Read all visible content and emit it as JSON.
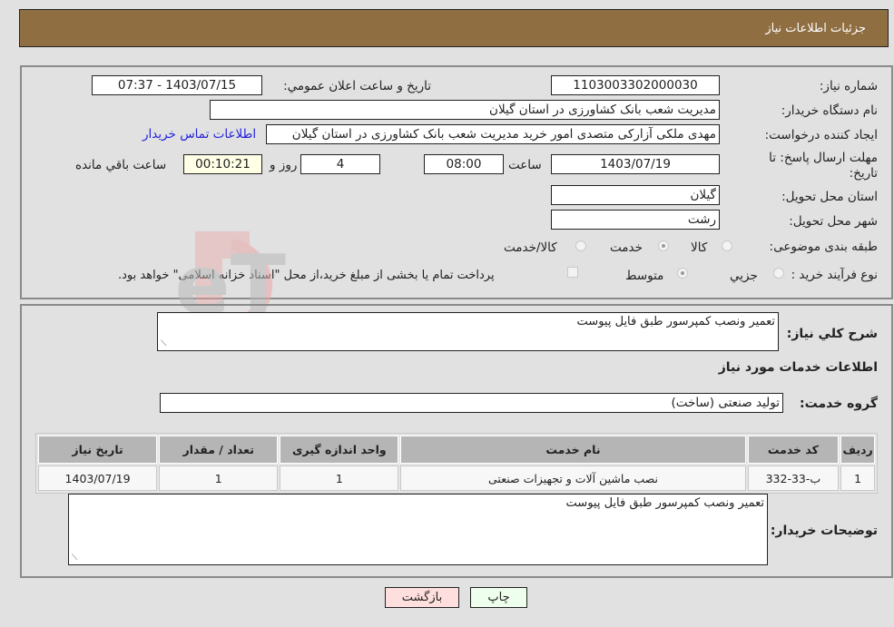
{
  "header": {
    "title": "جزئیات اطلاعات نیاز"
  },
  "form": {
    "need_number": {
      "label": "شماره نیاز:",
      "value": "1103003302000030"
    },
    "announce_datetime": {
      "label": "تاریخ و ساعت اعلان عمومي:",
      "value": "1403/07/15 - 07:37"
    },
    "buyer_org": {
      "label": "نام دستگاه خریدار:",
      "value": "مدیریت شعب بانک کشاورزی در استان گیلان"
    },
    "requester": {
      "label": "ایجاد کننده درخواست:",
      "value": "مهدی ملکی آزارکی متصدی امور خرید مدیریت شعب بانک کشاورزی در استان گیلان"
    },
    "buyer_contact_link": "اطلاعات تماس خریدار",
    "deadline": {
      "label": "مهلت ارسال پاسخ: تا تاریخ:",
      "date": "1403/07/19",
      "time_label": "ساعت",
      "time": "08:00",
      "days": "4",
      "days_label": "روز و",
      "remaining": "00:10:21",
      "remaining_label": "ساعت باقي مانده"
    },
    "delivery_province": {
      "label": "استان محل تحویل:",
      "value": "گیلان"
    },
    "delivery_city": {
      "label": "شهر محل تحویل:",
      "value": "رشت"
    },
    "category": {
      "label": "طبقه بندی موضوعی:",
      "options": [
        "کالا",
        "خدمت",
        "کالا/خدمت"
      ],
      "selected": "خدمت"
    },
    "purchase_type": {
      "label": "نوع فرآیند خرید :",
      "options": [
        "جزيي",
        "متوسط"
      ],
      "selected": "متوسط",
      "treasury_note": "پرداخت تمام یا بخشی از مبلغ خرید،از محل \"اسناد خزانه اسلامی\" خواهد بود."
    }
  },
  "details": {
    "general_desc_label": "شرح کلي نياز:",
    "general_desc": "تعمیر ونصب کمپرسور طبق فایل پیوست",
    "services_heading": "اطلاعات خدمات مورد نیاز",
    "service_group_label": "گروه خدمت:",
    "service_group": "تولید صنعتی (ساخت)",
    "table": {
      "headers": [
        "ردیف",
        "کد خدمت",
        "نام خدمت",
        "واحد اندازه گیری",
        "تعداد / مقدار",
        "تاریخ نیاز"
      ],
      "rows": [
        [
          "1",
          "ب-33-332",
          "نصب ماشین آلات و تجهیزات صنعتی",
          "1",
          "1",
          "1403/07/19"
        ]
      ]
    },
    "buyer_notes_label": "توضیحات خریدار:",
    "buyer_notes": "تعمیر ونصب کمپرسور طبق فایل پیوست"
  },
  "buttons": {
    "print": "چاپ",
    "back": "بازگشت"
  },
  "watermark": {
    "text": "AriaTender.neT"
  },
  "colors": {
    "header_bg": "#8f6e42",
    "link": "#2222dd",
    "print_bg": "#eeffee",
    "back_bg": "#ffdede",
    "remaining_bg": "#ffffe6"
  }
}
